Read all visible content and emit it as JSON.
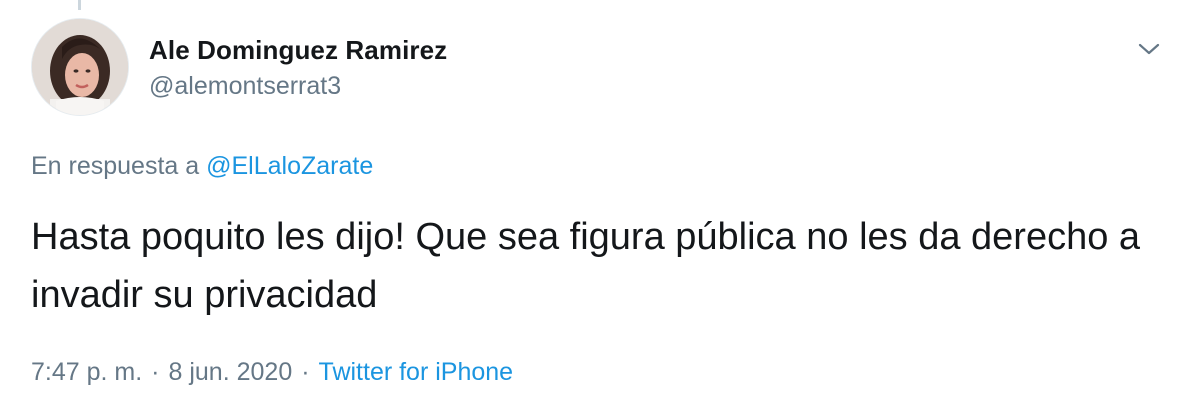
{
  "user": {
    "display_name": "Ale Dominguez Ramirez",
    "handle": "@alemontserrat3"
  },
  "reply": {
    "prefix": "En respuesta a",
    "mention": "@ElLaloZarate"
  },
  "tweet": {
    "text": "Hasta poquito les dijo! Que sea figura pública no les da derecho a invadir su privacidad"
  },
  "meta": {
    "time": "7:47 p. m.",
    "separator1": "·",
    "date": "8 jun. 2020",
    "separator2": "·",
    "source": "Twitter for iPhone"
  },
  "icons": {
    "menu": "chevron-down-icon"
  },
  "colors": {
    "text_primary": "#14171a",
    "text_secondary": "#657786",
    "link": "#1b95e0"
  }
}
